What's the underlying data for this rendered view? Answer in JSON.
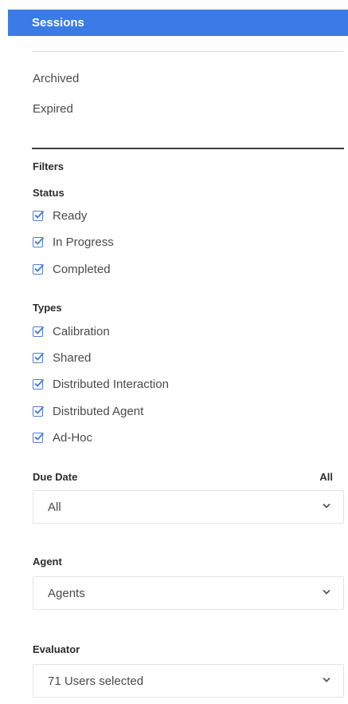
{
  "sessions_header": {
    "label": "Sessions"
  },
  "nav": {
    "archived": "Archived",
    "expired": "Expired"
  },
  "filters": {
    "title": "Filters",
    "status": {
      "title": "Status",
      "options": [
        {
          "label": "Ready",
          "checked": true
        },
        {
          "label": "In Progress",
          "checked": true
        },
        {
          "label": "Completed",
          "checked": true
        }
      ]
    },
    "types": {
      "title": "Types",
      "options": [
        {
          "label": "Calibration",
          "checked": true
        },
        {
          "label": "Shared",
          "checked": true
        },
        {
          "label": "Distributed Interaction",
          "checked": true
        },
        {
          "label": "Distributed Agent",
          "checked": true
        },
        {
          "label": "Ad-Hoc",
          "checked": true
        }
      ]
    },
    "due_date": {
      "title": "Due Date",
      "all_link": "All",
      "selected": "All"
    },
    "agent": {
      "title": "Agent",
      "selected": "Agents"
    },
    "evaluator": {
      "title": "Evaluator",
      "selected": "71 Users selected"
    }
  },
  "colors": {
    "header_bg": "#3a7be6",
    "checkbox": "#4b7fd9",
    "text": "#4a4a4a"
  },
  "icons": {
    "checkbox": "checkmark-icon",
    "dropdown": "chevron-down-icon"
  }
}
